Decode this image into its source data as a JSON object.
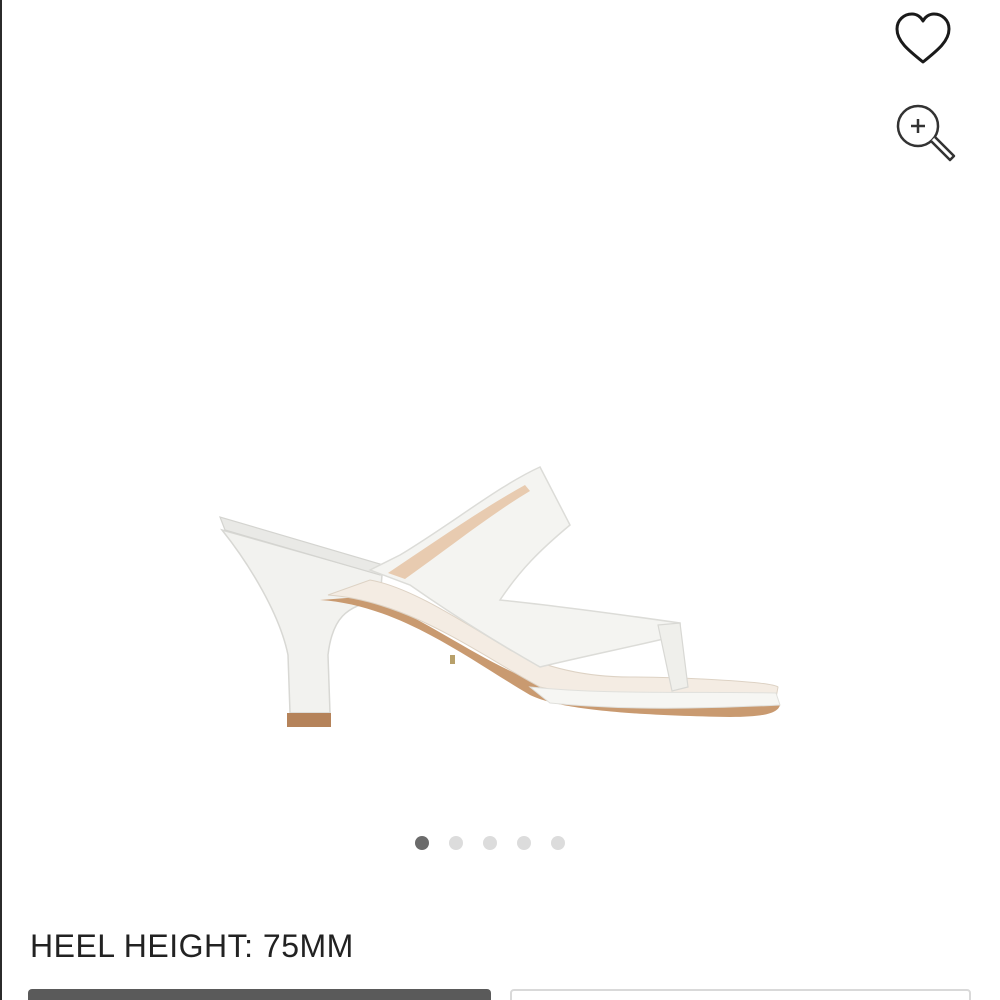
{
  "header_actions": {
    "favorite_icon": "heart-outline-icon",
    "zoom_icon": "zoom-in-magnifier-icon"
  },
  "product": {
    "image_alt": "white leather square-toe thong mule sandal",
    "spec_label": "HEEL HEIGHT: 75MM"
  },
  "carousel": {
    "total": 5,
    "active_index": 0
  },
  "colors": {
    "active_dot": "#6b6b6b",
    "inactive_dot": "#dcdcdc",
    "primary_button": "#5a5a5a",
    "secondary_button_border": "#d9d9d9"
  }
}
